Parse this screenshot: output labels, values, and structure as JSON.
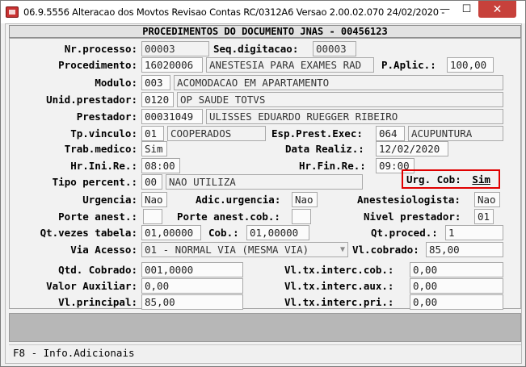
{
  "window": {
    "title": "06.9.5556  Alteracao  dos Movtos Revisao Contas RC/0312A6 Versao 2.00.02.070 24/02/2020 - ",
    "min_glyph": "—",
    "max_glyph": "☐",
    "close_glyph": "✕"
  },
  "header": {
    "title": "PROCEDIMENTOS DO DOCUMENTO JNAS - 00456123"
  },
  "form": {
    "nr_processo": {
      "label": "Nr.processo:",
      "value": "00003"
    },
    "seq_digitacao": {
      "label": "Seq.digitacao:",
      "value": "00003"
    },
    "procedimento": {
      "label": "Procedimento:",
      "code": "16020006",
      "desc": "ANESTESIA PARA EXAMES RAD"
    },
    "p_aplic": {
      "label": "P.Aplic.:",
      "value": "100,00"
    },
    "modulo": {
      "label": "Modulo:",
      "code": "003",
      "desc": "ACOMODACAO EM APARTAMENTO"
    },
    "unid_prestador": {
      "label": "Unid.prestador:",
      "code": "0120",
      "desc": "OP SAUDE TOTVS"
    },
    "prestador": {
      "label": "Prestador:",
      "code": "00031049",
      "desc": "ULISSES EDUARDO RUEGGER RIBEIRO"
    },
    "tp_vinculo": {
      "label": "Tp.vinculo:",
      "code": "01",
      "desc": "COOPERADOS"
    },
    "esp_prest_exec": {
      "label": "Esp.Prest.Exec:",
      "code": "064",
      "desc": "ACUPUNTURA"
    },
    "trab_medico": {
      "label": "Trab.medico:",
      "value": "Sim"
    },
    "data_realiz": {
      "label": "Data Realiz.:",
      "value": "12/02/2020"
    },
    "hr_ini_re": {
      "label": "Hr.Ini.Re.:",
      "value": "08:00"
    },
    "hr_fin_re": {
      "label": "Hr.Fin.Re.:",
      "value": "09:00"
    },
    "tipo_percent": {
      "label": "Tipo percent.:",
      "code": "00",
      "desc": "NAO UTILIZA"
    },
    "urg_cob": {
      "label": "Urg. Cob:",
      "value": "Sim"
    },
    "urgencia": {
      "label": "Urgencia:",
      "value": "Nao"
    },
    "adic_urgencia": {
      "label": "Adic.urgencia:",
      "value": "Nao"
    },
    "anestesiologista": {
      "label": "Anestesiologista:",
      "value": "Nao"
    },
    "porte_anest": {
      "label": "Porte anest.:",
      "value": ""
    },
    "porte_anest_cob": {
      "label": "Porte anest.cob.:",
      "value": ""
    },
    "nivel_prestador": {
      "label": "Nivel prestador:",
      "value": "01"
    },
    "qt_vezes_tabela": {
      "label": "Qt.vezes tabela:",
      "value": "01,00000"
    },
    "cob": {
      "label": "Cob.:",
      "value": "01,00000"
    },
    "qt_proced": {
      "label": "Qt.proced.:",
      "value": "1"
    },
    "via_acesso": {
      "label": "Via Acesso:",
      "value": "01 - NORMAL VIA (MESMA VIA)",
      "arrow": "▼"
    },
    "vl_cobrado": {
      "label": "Vl.cobrado:",
      "value": "85,00"
    },
    "qtd_cobrado": {
      "label": "Qtd. Cobrado:",
      "value": "001,0000"
    },
    "vl_tx_interc_cob": {
      "label": "Vl.tx.interc.cob.:",
      "value": "0,00"
    },
    "valor_auxiliar": {
      "label": "Valor Auxiliar:",
      "value": "0,00"
    },
    "vl_tx_interc_aux": {
      "label": "Vl.tx.interc.aux.:",
      "value": "0,00"
    },
    "vl_principal": {
      "label": "Vl.principal:",
      "value": "85,00"
    },
    "vl_tx_interc_pri": {
      "label": "Vl.tx.interc.pri.:",
      "value": "0,00"
    }
  },
  "status": {
    "text": "F8 - Info.Adicionais"
  },
  "colors": {
    "highlight_border": "#e00000",
    "close_button": "#c7413b"
  }
}
